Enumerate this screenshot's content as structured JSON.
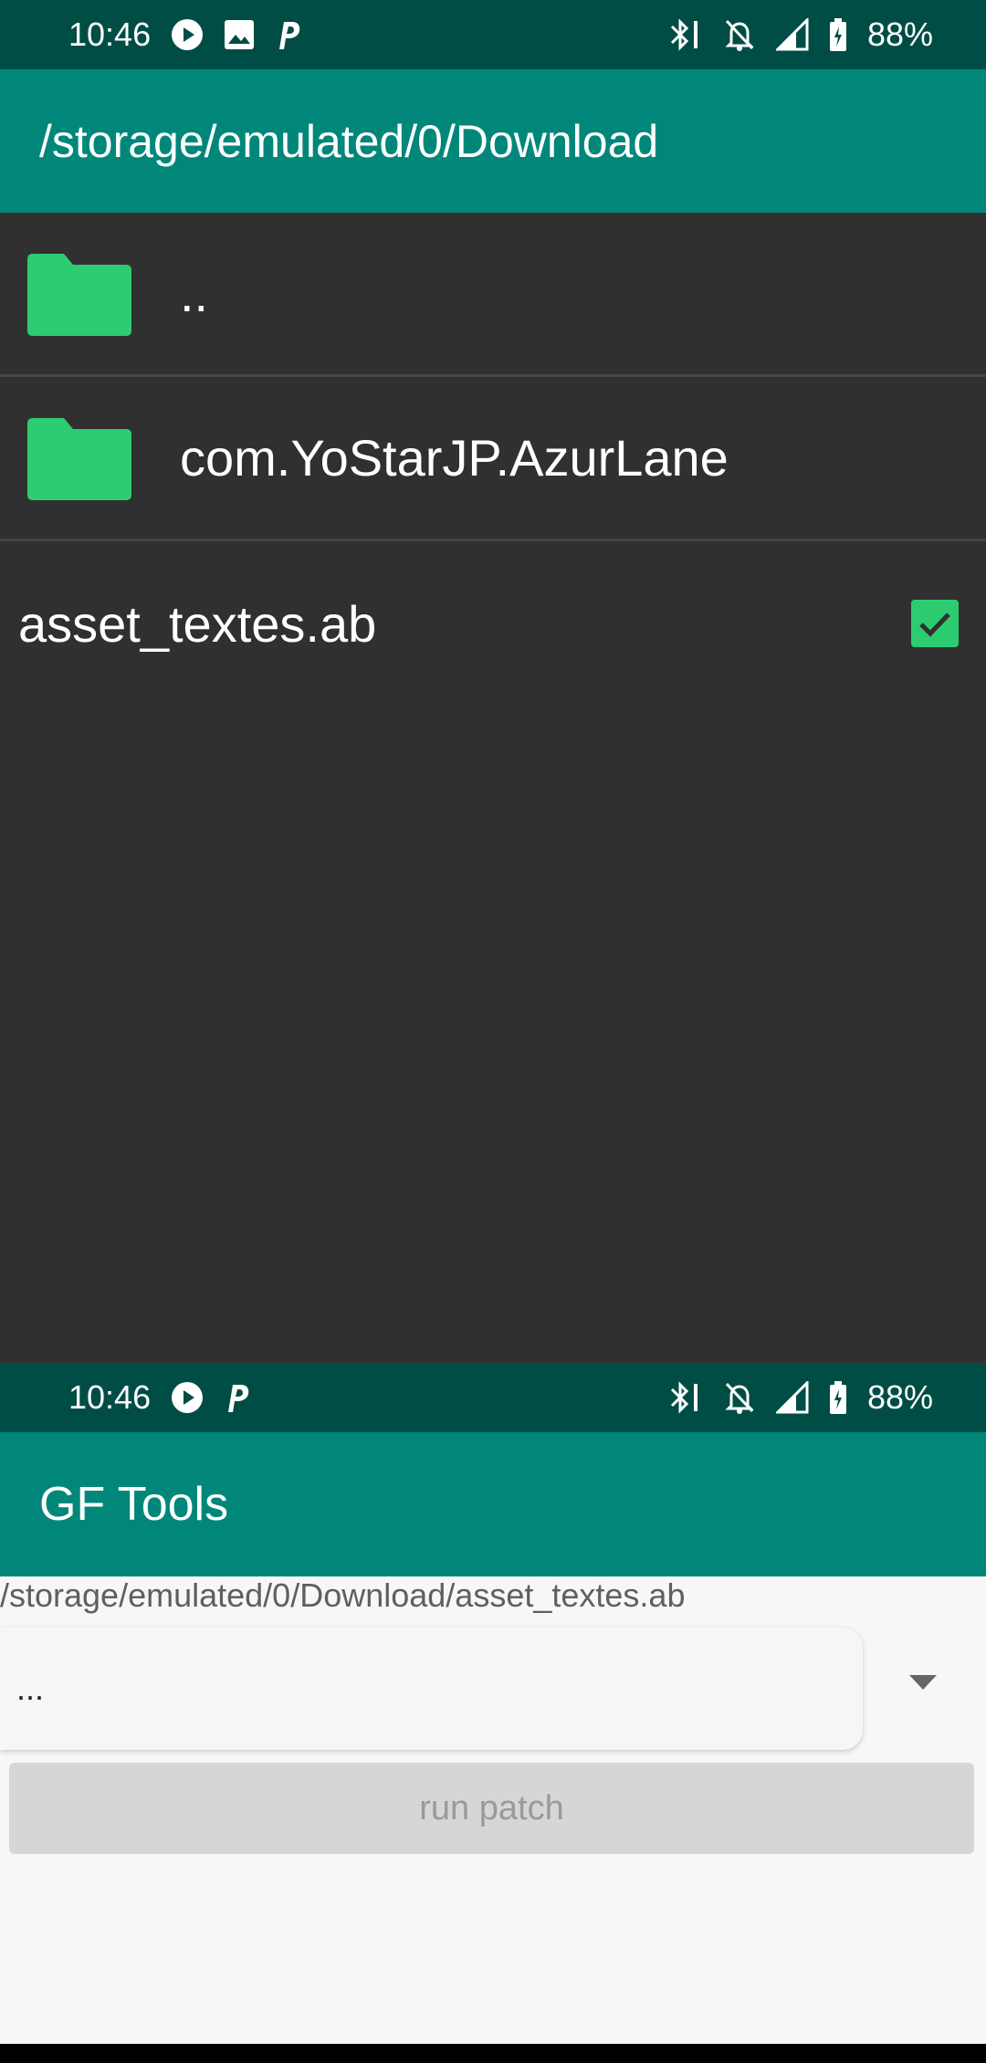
{
  "top_status": {
    "time": "10:46",
    "battery": "88%"
  },
  "file_picker": {
    "title": "/storage/emulated/0/Download",
    "items": [
      {
        "label": "..",
        "type": "folder"
      },
      {
        "label": "com.YoStarJP.AzurLane",
        "type": "folder"
      }
    ],
    "file": {
      "label": "asset_textes.ab",
      "checked": true
    }
  },
  "bottom_status": {
    "time": "10:46",
    "battery": "88%"
  },
  "app": {
    "title": "GF Tools",
    "selected_path": "/storage/emulated/0/Download/asset_textes.ab",
    "dropdown_value": "...",
    "run_button": "run patch"
  },
  "colors": {
    "status_bar": "#004d45",
    "app_bar": "#00877a",
    "list_bg": "#303030",
    "accent_green": "#2ecc71"
  }
}
